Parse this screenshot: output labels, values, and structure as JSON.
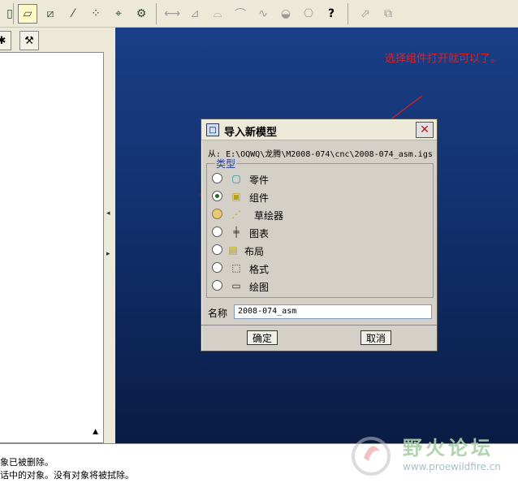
{
  "toolbar": {
    "buttons": [
      {
        "name": "datum-plane-icon",
        "glyph": "▱"
      },
      {
        "name": "datum-plane-tool-icon",
        "glyph": "⧄"
      },
      {
        "name": "datum-axis-icon",
        "glyph": "⁄"
      },
      {
        "name": "datum-point-icon",
        "glyph": "⁘"
      },
      {
        "name": "coordinate-system-icon",
        "glyph": "⌖"
      },
      {
        "name": "analysis-icon",
        "glyph": "⚙"
      },
      {
        "name": "measure-icon",
        "glyph": "⟷"
      },
      {
        "name": "model-analysis-icon",
        "glyph": "⊿"
      },
      {
        "name": "sketch-analysis-icon",
        "glyph": "⌓"
      },
      {
        "name": "curvature-icon",
        "glyph": "⌒"
      },
      {
        "name": "graph-icon",
        "glyph": "∿"
      },
      {
        "name": "surface-analysis-icon",
        "glyph": "◒"
      },
      {
        "name": "reference-icon",
        "glyph": "⎔"
      },
      {
        "name": "whats-this-help-icon",
        "glyph": "?"
      },
      {
        "name": "cursor-select-icon",
        "glyph": "⬀"
      },
      {
        "name": "layer-select-icon",
        "glyph": "⧉"
      }
    ]
  },
  "annotation": {
    "text": "选择组件打开就可以了。",
    "color": "#e02020"
  },
  "dialog": {
    "title": "导入新模型",
    "close_glyph": "✕",
    "from_label": "从:",
    "from_path": "E:\\OQWQ\\龙腾\\M2008-074\\cnc\\2008-074_asm.igs",
    "type_legend": "类型",
    "types": [
      {
        "label": "零件",
        "icon": "part-icon",
        "glyph": "▢",
        "state": "unchecked"
      },
      {
        "label": "组件",
        "icon": "assembly-icon",
        "glyph": "▣",
        "state": "checked"
      },
      {
        "label": "草绘器",
        "icon": "sketch-icon",
        "glyph": "⋰",
        "state": "disabled"
      },
      {
        "label": "图表",
        "icon": "diagram-icon",
        "glyph": "╪",
        "state": "unchecked"
      },
      {
        "label": "布局",
        "icon": "layout-icon",
        "glyph": "▤",
        "state": "unchecked"
      },
      {
        "label": "格式",
        "icon": "format-icon",
        "glyph": "⬚",
        "state": "unchecked"
      },
      {
        "label": "绘图",
        "icon": "drawing-icon",
        "glyph": "▭",
        "state": "unchecked"
      }
    ],
    "name_label": "名称",
    "name_value": "2008-074_asm",
    "ok_label": "确定",
    "cancel_label": "取消"
  },
  "status": {
    "lines": [
      "象已被删除。",
      "话中的对象。没有对象将被拭除。"
    ]
  },
  "watermark": {
    "title": "野火论坛",
    "url": "www.proewildfire.cn"
  }
}
